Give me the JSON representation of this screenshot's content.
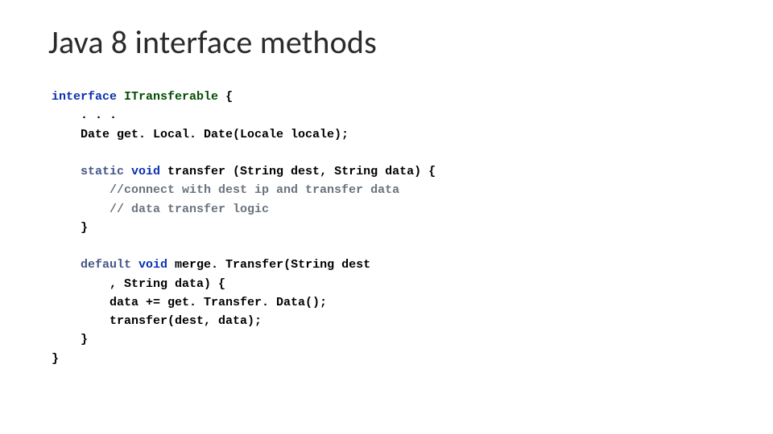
{
  "title": "Java 8 interface methods",
  "code": {
    "l1_kw": "interface",
    "l1_cls": "ITransferable",
    "l1_brace": " {",
    "l2": "    . . .",
    "l3": "    Date get. Local. Date(Locale locale);",
    "blank1": "",
    "l4a_kw": "    static",
    "l4b_kw": " void",
    "l4c": " transfer (String dest, String data)",
    "l4d": " {",
    "l5": "        //connect with dest ip and transfer data",
    "l6": "        // data transfer logic",
    "l7": "    }",
    "blank2": "",
    "l8a_kw": "    default",
    "l8b_kw": " void",
    "l8c": " merge. Transfer(String dest",
    "l9": "        , String data) {",
    "l10": "        data += get. Transfer. Data();",
    "l11": "        transfer(dest, data);",
    "l12": "    }",
    "l13": "}"
  }
}
